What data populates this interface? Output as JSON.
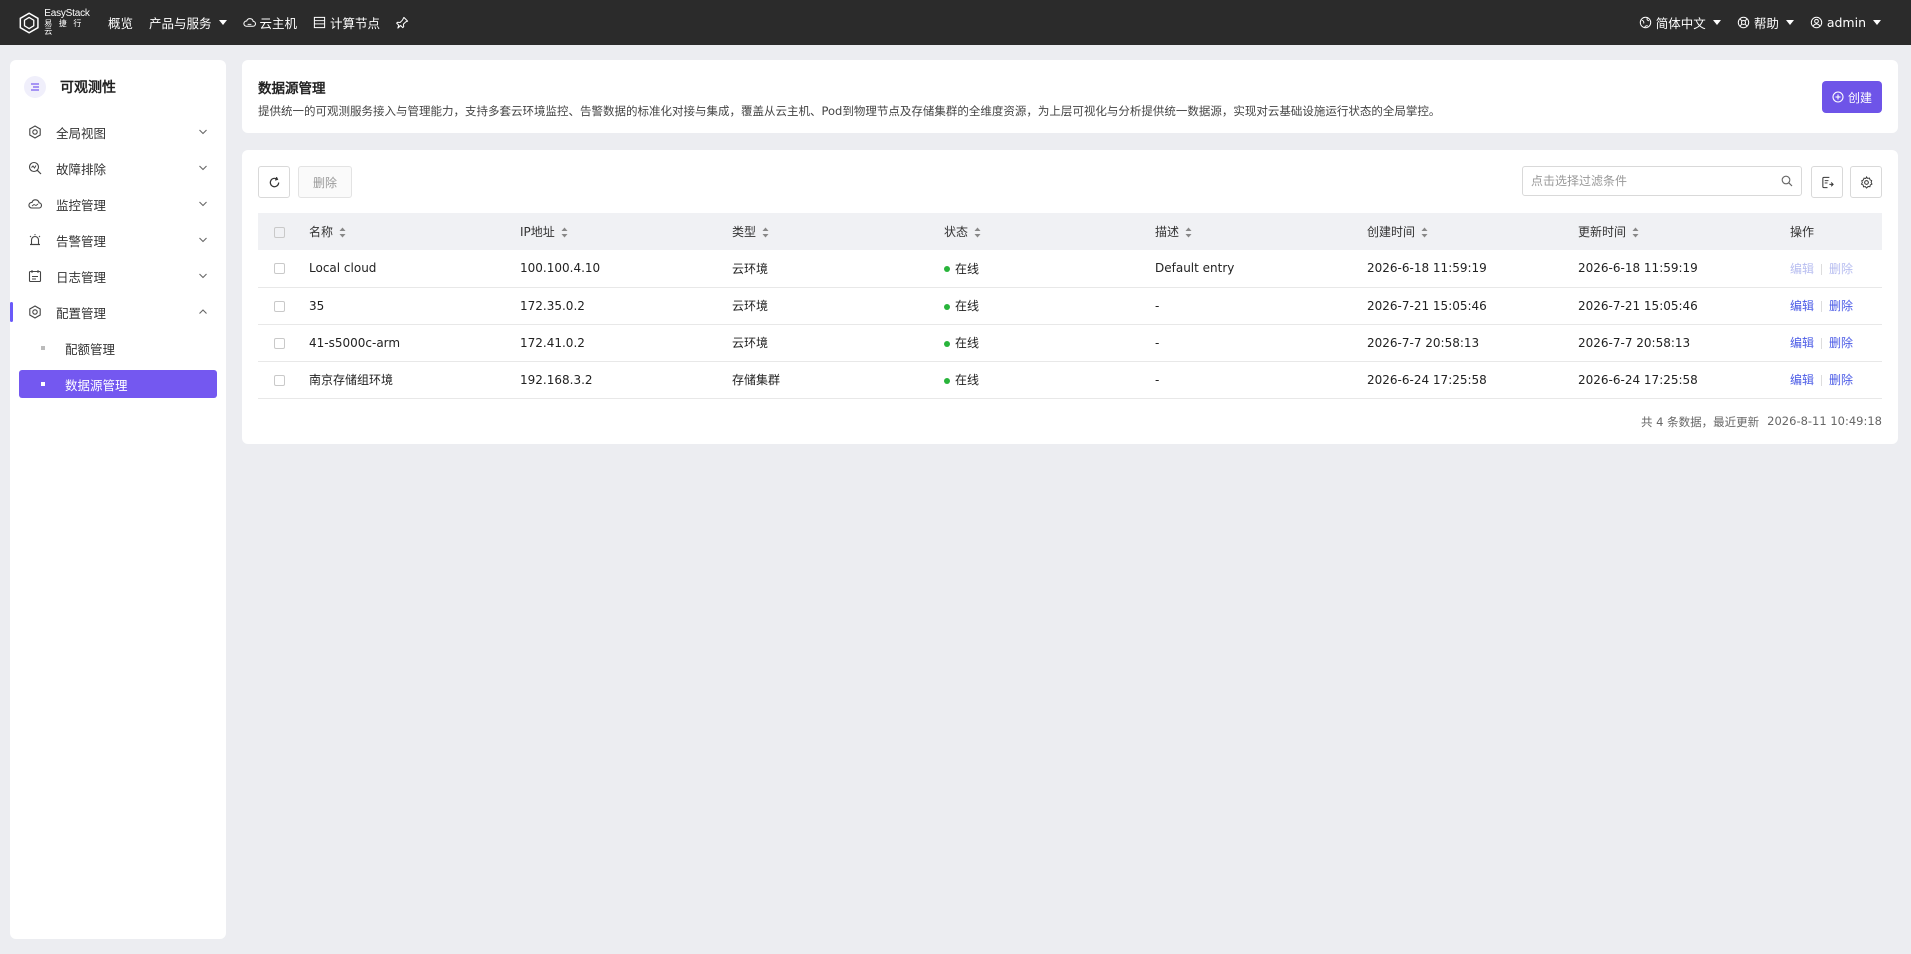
{
  "topbar": {
    "brand_name": "EasyStack",
    "brand_sub": "易 捷 行 云",
    "nav": [
      {
        "label": "概览"
      },
      {
        "label": "产品与服务"
      },
      {
        "label": "云主机"
      },
      {
        "label": "计算节点"
      }
    ],
    "language": "简体中文",
    "help": "帮助",
    "user": "admin"
  },
  "sidebar": {
    "title": "可观测性",
    "items": [
      {
        "label": "全局视图"
      },
      {
        "label": "故障排除"
      },
      {
        "label": "监控管理"
      },
      {
        "label": "告警管理"
      },
      {
        "label": "日志管理"
      },
      {
        "label": "配置管理"
      }
    ],
    "sub_items": [
      {
        "label": "配额管理"
      },
      {
        "label": "数据源管理"
      }
    ]
  },
  "header": {
    "title": "数据源管理",
    "description": "提供统一的可观测服务接入与管理能力，支持多套云环境监控、告警数据的标准化对接与集成，覆盖从云主机、Pod到物理节点及存储集群的全维度资源，为上层可视化与分析提供统一数据源，实现对云基础设施运行状态的全局掌控。",
    "create_label": "创建"
  },
  "toolbar": {
    "delete_label": "删除",
    "search_placeholder": "点击选择过滤条件"
  },
  "table": {
    "columns": [
      "名称",
      "IP地址",
      "类型",
      "状态",
      "描述",
      "创建时间",
      "更新时间",
      "操作"
    ],
    "edit_label": "编辑",
    "delete_label": "删除",
    "rows": [
      {
        "name": "Local cloud",
        "ip": "100.100.4.10",
        "type": "云环境",
        "status": "在线",
        "desc": "Default entry",
        "created": "2026-6-18 11:59:19",
        "updated": "2026-6-18 11:59:19"
      },
      {
        "name": "35",
        "ip": "172.35.0.2",
        "type": "云环境",
        "status": "在线",
        "desc": "-",
        "created": "2026-7-21 15:05:46",
        "updated": "2026-7-21 15:05:46"
      },
      {
        "name": "41-s5000c-arm",
        "ip": "172.41.0.2",
        "type": "云环境",
        "status": "在线",
        "desc": "-",
        "created": "2026-7-7 20:58:13",
        "updated": "2026-7-7 20:58:13"
      },
      {
        "name": "南京存储组环境",
        "ip": "192.168.3.2",
        "type": "存储集群",
        "status": "在线",
        "desc": "-",
        "created": "2026-6-24 17:25:58",
        "updated": "2026-6-24 17:25:58"
      }
    ]
  },
  "footer": {
    "summary": "共 4 条数据，最近更新",
    "last_updated": "2026-8-11 10:49:18"
  },
  "colors": {
    "accent": "#6e54e8",
    "topbar": "#2b2b2b",
    "online": "#29b43b",
    "link": "#4b5be6"
  }
}
